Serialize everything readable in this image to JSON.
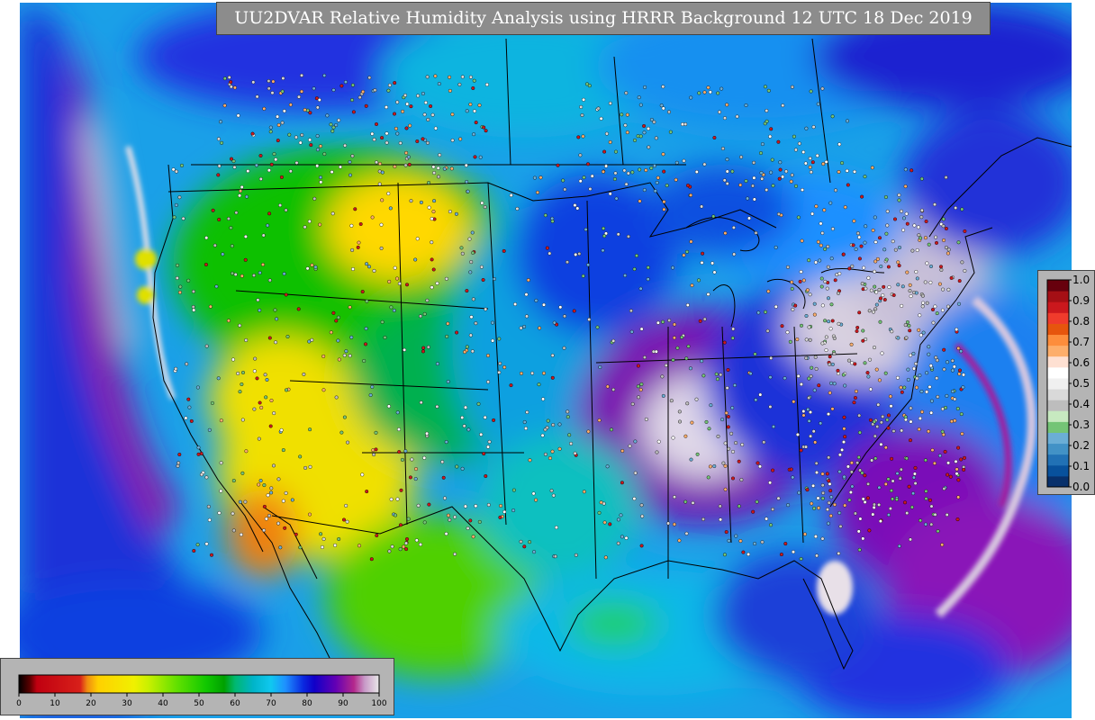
{
  "title": "UU2DVAR Relative Humidity Analysis using HRRR Background 12 UTC 18 Dec 2019",
  "rh_colorbar": {
    "ticks": [
      "0",
      "10",
      "20",
      "30",
      "40",
      "50",
      "60",
      "70",
      "80",
      "90",
      "100"
    ],
    "stops": [
      {
        "value": 0,
        "color": "#000000"
      },
      {
        "value": 3,
        "color": "#5a0000"
      },
      {
        "value": 5,
        "color": "#c00010"
      },
      {
        "value": 17,
        "color": "#d8201a"
      },
      {
        "value": 19,
        "color": "#f08c10"
      },
      {
        "value": 22,
        "color": "#ffd000"
      },
      {
        "value": 32,
        "color": "#f0f000"
      },
      {
        "value": 36,
        "color": "#c8f000"
      },
      {
        "value": 44,
        "color": "#60e000"
      },
      {
        "value": 52,
        "color": "#10c800"
      },
      {
        "value": 57,
        "color": "#00a000"
      },
      {
        "value": 60,
        "color": "#00b870"
      },
      {
        "value": 65,
        "color": "#00b4c8"
      },
      {
        "value": 70,
        "color": "#10c8f0"
      },
      {
        "value": 74,
        "color": "#1e90ff"
      },
      {
        "value": 79,
        "color": "#0a28e0"
      },
      {
        "value": 82,
        "color": "#1000c8"
      },
      {
        "value": 88,
        "color": "#6400b4"
      },
      {
        "value": 93,
        "color": "#b4288c"
      },
      {
        "value": 96,
        "color": "#c89ac8"
      },
      {
        "value": 100,
        "color": "#e8e8e8"
      }
    ]
  },
  "obs_colorbar": {
    "ticks": [
      "0.0",
      "0.1",
      "0.2",
      "0.3",
      "0.4",
      "0.5",
      "0.6",
      "0.7",
      "0.8",
      "0.9",
      "1.0"
    ],
    "colors": [
      "#08306b",
      "#08519c",
      "#2171b5",
      "#4292c6",
      "#6baed6",
      "#74c476",
      "#c7e9c0",
      "#bdbdbd",
      "#d9d9d9",
      "#f0f0f0",
      "#ffffff",
      "#fee0d2",
      "#fdae6b",
      "#fd8d3c",
      "#e6550d",
      "#ef3b2c",
      "#cb181d",
      "#a50f15",
      "#67000d"
    ]
  }
}
